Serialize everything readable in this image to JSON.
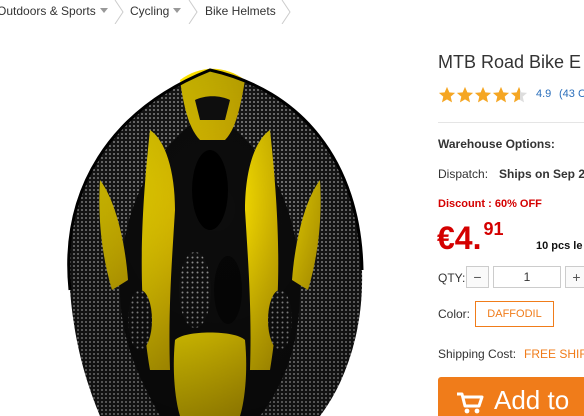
{
  "breadcrumb": {
    "items": [
      {
        "label": "Outdoors & Sports",
        "has_dropdown": true
      },
      {
        "label": "Cycling",
        "has_dropdown": true
      },
      {
        "label": "Bike Helmets",
        "has_dropdown": false
      }
    ]
  },
  "product": {
    "title": "MTB Road Bike E",
    "rating_value": "4.9",
    "rating_count": "(43 C",
    "stars": 4.5,
    "image_icon": "bike-helmet-photo"
  },
  "options": {
    "warehouse_label": "Warehouse Options:",
    "dispatch_label": "Dispatch:",
    "dispatch_value": "Ships on Sep 2",
    "discount": "Discount : 60% OFF",
    "price_main": "€4.",
    "price_cents": "91",
    "lots_text": "10 pcs le",
    "qty_label": "QTY:",
    "qty_value": "1",
    "qty_minus": "−",
    "qty_plus": "+",
    "color_label": "Color:",
    "color_value": "DAFFODIL",
    "shipping_label": "Shipping Cost:",
    "shipping_value": "FREE SHIF",
    "add_to_cart": "Add to"
  },
  "colors": {
    "accent": "#f07c1a",
    "price": "#d40000",
    "link": "#2a6ebb",
    "star": "#f5a623"
  }
}
